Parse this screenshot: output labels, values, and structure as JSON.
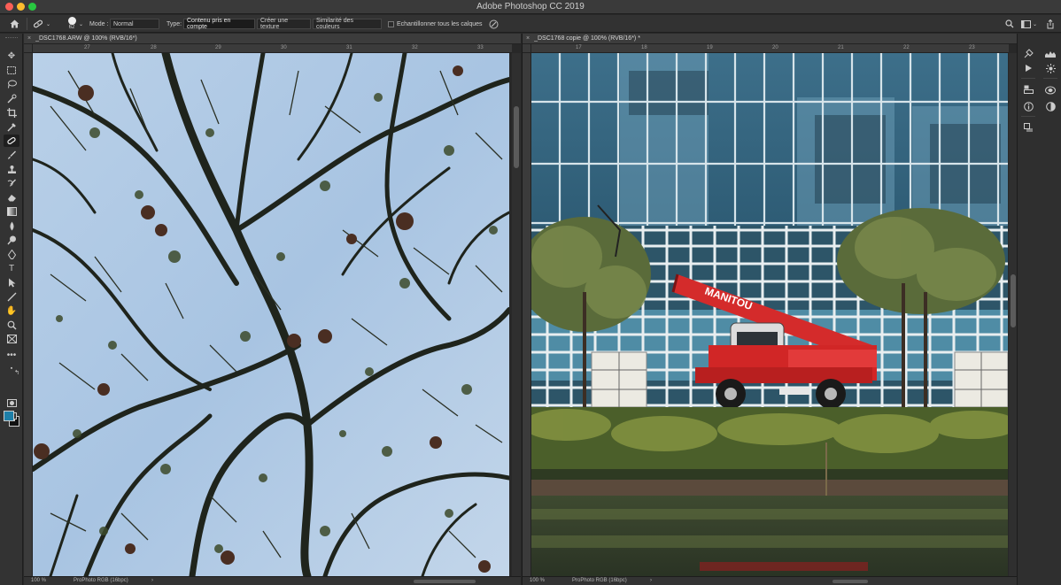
{
  "window": {
    "title": "Adobe Photoshop CC 2019"
  },
  "options": {
    "brush_size": "62",
    "mode_label": "Mode :",
    "mode_value": "Normal",
    "type_label": "Type:",
    "type_buttons": [
      "Contenu pris en compte",
      "Créer une texture",
      "Similarité des couleurs"
    ],
    "sample_all_layers": "Echantillonner tous les calques"
  },
  "colors": {
    "foreground": "#1e7fa8",
    "background": "#111111"
  },
  "toolbar": {
    "tools": [
      "move-icon",
      "marquee-icon",
      "lasso-icon",
      "quick-select-icon",
      "crop-icon",
      "eyedropper-icon",
      "healing-brush-icon",
      "brush-icon",
      "clone-stamp-icon",
      "history-brush-icon",
      "eraser-icon",
      "gradient-icon",
      "blur-icon",
      "dodge-icon",
      "pen-icon",
      "type-icon",
      "path-select-icon",
      "line-icon",
      "hand-icon",
      "zoom-icon",
      "frame-icon",
      "more-tools-icon",
      "quick-mask-icon",
      "screen-mode-icon"
    ],
    "active_tool": "healing-brush-icon"
  },
  "documents": [
    {
      "tab_title": "_DSC1768.ARW @ 100% (RVB/16*)",
      "close": "×",
      "ruler_labels": [
        "27",
        "28",
        "29",
        "30",
        "31",
        "32",
        "33"
      ],
      "zoom": "100 %",
      "profile": "ProPhoto RGB (16bpc)",
      "arrow": "›"
    },
    {
      "tab_title": "_DSC1768 copie @ 100% (RVB/16*) *",
      "close": "×",
      "ruler_labels": [
        "17",
        "18",
        "19",
        "20",
        "21",
        "22",
        "23"
      ],
      "zoom": "100 %",
      "profile": "ProPhoto RGB (16bpc)",
      "arrow": "›",
      "vehicle_text": "MANITOU"
    }
  ],
  "dock": {
    "col1": [
      "brushes-panel-icon",
      "actions-panel-icon",
      "libraries-panel-icon",
      "info-panel-icon",
      "properties-panel-icon"
    ],
    "col2": [
      "histogram-panel-icon",
      "adjustments-panel-icon",
      "channels-panel-icon",
      "mask-panel-icon"
    ]
  }
}
